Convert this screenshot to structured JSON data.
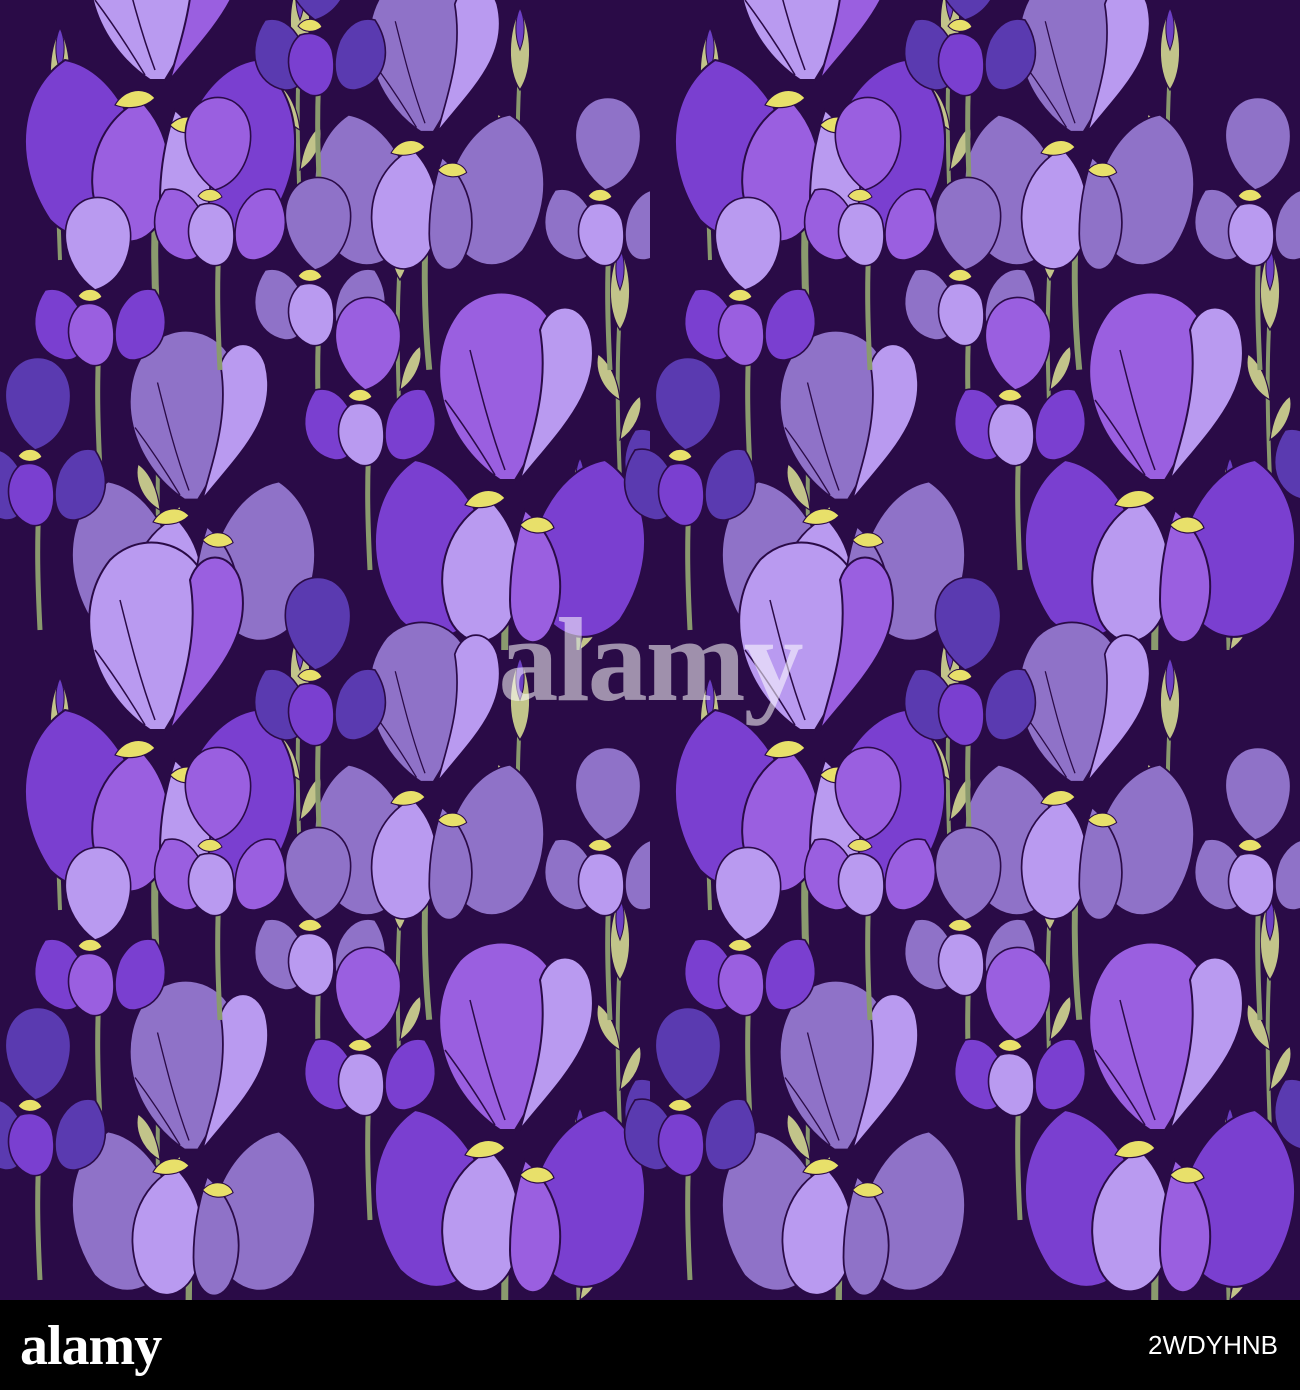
{
  "image": {
    "subject": "seamless floral pattern of purple iris flowers with buds and stems",
    "colors": {
      "background": "#2a0b47",
      "petal_light": "#b99af0",
      "petal_mid": "#9a5fe0",
      "petal_violet": "#7a3fd0",
      "petal_blue": "#5a3ab0",
      "petal_muted": "#8f72c8",
      "outline": "#2a0b47",
      "beard": "#e8e06a",
      "stem": "#8a9a6e",
      "bud_leaf": "#c2c48a",
      "bud_tip": "#6c3fc4"
    }
  },
  "watermark": {
    "text": "alamy"
  },
  "footer": {
    "brand": "alamy",
    "stock_id": "2WDYHNB"
  }
}
